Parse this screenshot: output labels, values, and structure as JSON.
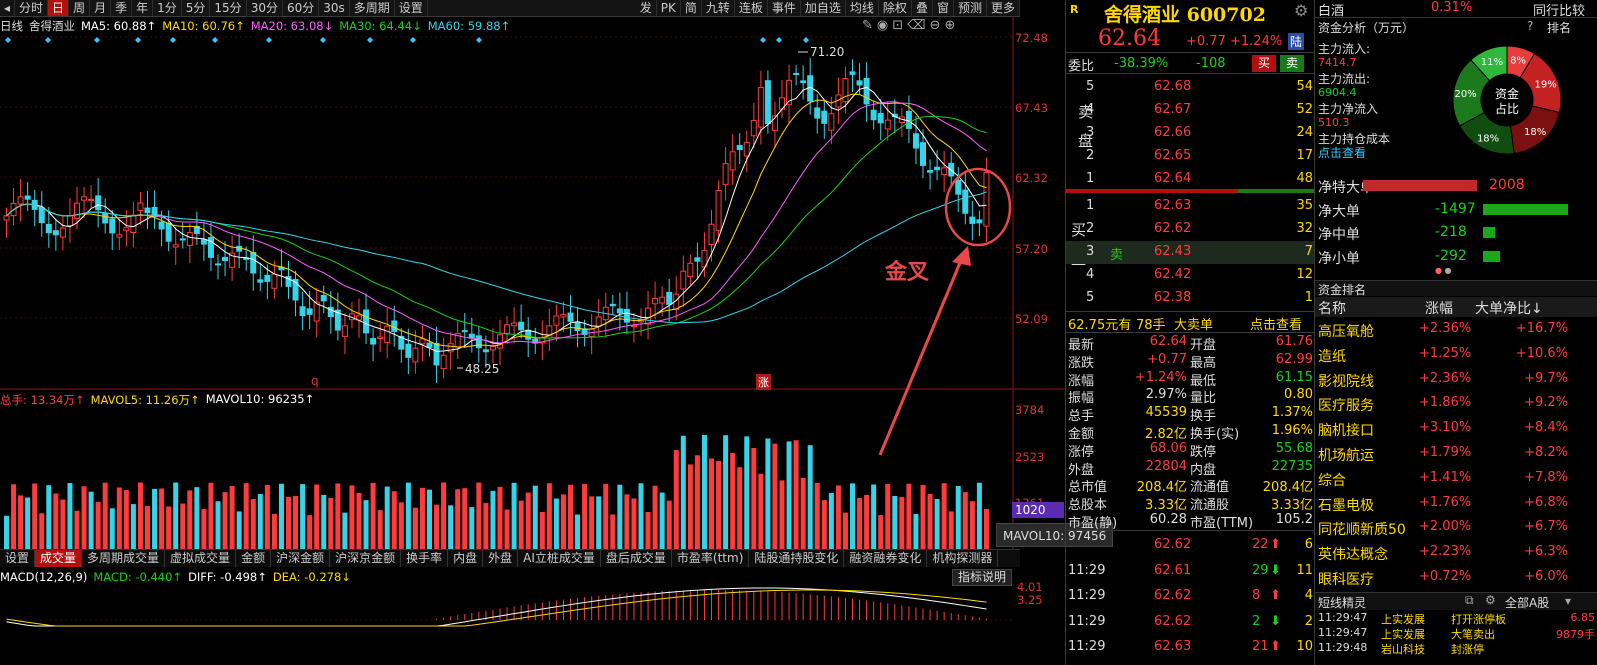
{
  "toolbar": {
    "items": [
      "分时",
      "日",
      "周",
      "月",
      "季",
      "年",
      "1分",
      "5分",
      "15分",
      "30分",
      "60分",
      "30s",
      "多周期",
      "设置"
    ],
    "active_index": 1,
    "right_items": [
      "发",
      "PK",
      "简",
      "九转",
      "连板",
      "事件",
      "加自选",
      "均线",
      "除权",
      "叠",
      "窗",
      "预测",
      "更多"
    ]
  },
  "info_line": {
    "period": "日线",
    "stock_name": "舍得酒业",
    "ma5": "MA5: 60.88↑",
    "ma10": "MA10: 60.76↑",
    "ma20": "MA20: 63.08↓",
    "ma30": "MA30: 64.44↓",
    "ma60": "MA60: 59.88↑"
  },
  "price_axis": [
    "72.48",
    "67.43",
    "62.32",
    "57.20",
    "52.09"
  ],
  "price_labels": {
    "high": "71.20",
    "low": "48.25",
    "q_marker": "q",
    "zhang_marker": "涨"
  },
  "annotation": {
    "text": "金叉",
    "color": "#e84848"
  },
  "volume_info": {
    "total": "总手: 13.34万↑",
    "mavol5": "MAVOL5: 11.26万↑",
    "mavol10": "MAVOL10: 96235↑"
  },
  "volume_axis": [
    "3784",
    "2523",
    "1261"
  ],
  "volume_current": "1020",
  "tooltip": "MAVOL10: 97456",
  "bottom_tabs": [
    "设置",
    "成交量",
    "多周期成交量",
    "虚拟成交量",
    "金额",
    "沪深金额",
    "沪深京金额",
    "换手率",
    "内盘",
    "外盘",
    "AI立桩成交量",
    "盘后成交量",
    "市盈率(ttm)",
    "陆股通持股变化",
    "融资融券变化",
    "机构探测器"
  ],
  "bottom_tab_active": 1,
  "macd_info": {
    "label": "MACD(12,26,9)",
    "macd": "MACD: -0.440↑",
    "diff": "DIFF: -0.498↑",
    "dea": "DEA: -0.278↓"
  },
  "macd_axis": [
    "4.01",
    "3.25"
  ],
  "indicator_button": "指标说明",
  "quote": {
    "badge": "R",
    "title": "舍得酒业 600702",
    "price": "62.64",
    "change": "+0.77",
    "pct": "+1.24%",
    "exchange_tag": "陆",
    "weibi_label": "委比",
    "weibi": "-38.39%",
    "weicha": "-108",
    "buy_btn": "买",
    "sell_btn": "卖"
  },
  "sell_orders": [
    {
      "level": "5",
      "price": "62.68",
      "vol": "54"
    },
    {
      "level": "4",
      "price": "62.67",
      "vol": "52"
    },
    {
      "level": "3",
      "price": "62.66",
      "vol": "24"
    },
    {
      "level": "2",
      "price": "62.65",
      "vol": "17"
    },
    {
      "level": "1",
      "price": "62.64",
      "vol": "48"
    }
  ],
  "sell_side_label": "卖盘",
  "buy_orders": [
    {
      "level": "1",
      "price": "62.63",
      "vol": "35"
    },
    {
      "level": "2",
      "price": "62.62",
      "vol": "32"
    },
    {
      "level": "3",
      "price": "62.43",
      "vol": "7",
      "tag": "卖"
    },
    {
      "level": "4",
      "price": "62.42",
      "vol": "12"
    },
    {
      "level": "5",
      "price": "62.38",
      "vol": "1"
    }
  ],
  "buy_side_label": "买盘",
  "big_order_line": {
    "amount": "62.75元有",
    "hands": "78手",
    "label": "大卖单",
    "link": "点击查看"
  },
  "stats": [
    {
      "k1": "最新",
      "v1": "62.64",
      "k2": "开盘",
      "v2": "61.76"
    },
    {
      "k1": "涨跌",
      "v1": "+0.77",
      "k2": "最高",
      "v2": "62.99"
    },
    {
      "k1": "涨幅",
      "v1": "+1.24%",
      "k2": "最低",
      "v2": "61.15"
    },
    {
      "k1": "振幅",
      "v1": "2.97%",
      "k2": "量比",
      "v2": "0.80"
    },
    {
      "k1": "总手",
      "v1": "45539",
      "k2": "换手",
      "v2": "1.37%"
    },
    {
      "k1": "金额",
      "v1": "2.82亿",
      "k2": "换手(实)",
      "v2": "1.96%"
    },
    {
      "k1": "涨停",
      "v1": "68.06",
      "k2": "跌停",
      "v2": "55.68"
    },
    {
      "k1": "外盘",
      "v1": "22804",
      "k2": "内盘",
      "v2": "22735"
    },
    {
      "k1": "总市值",
      "v1": "208.4亿",
      "k2": "流通值",
      "v2": "208.4亿"
    },
    {
      "k1": "总股本",
      "v1": "3.33亿",
      "k2": "流通股",
      "v2": "3.33亿"
    },
    {
      "k1": "市盈(静)",
      "v1": "60.28",
      "k2": "市盈(TTM)",
      "v2": "105.2"
    }
  ],
  "ticks": [
    {
      "time": "",
      "price": "62.62",
      "vol": "22",
      "dir": "up",
      "n": "6"
    },
    {
      "time": "11:29",
      "price": "62.61",
      "vol": "29",
      "dir": "down",
      "n": "11"
    },
    {
      "time": "11:29",
      "price": "62.62",
      "vol": "8",
      "dir": "up",
      "n": "4"
    },
    {
      "time": "11:29",
      "price": "62.62",
      "vol": "2",
      "dir": "down",
      "n": "2"
    },
    {
      "time": "11:29",
      "price": "62.63",
      "vol": "21",
      "dir": "up",
      "n": "10"
    }
  ],
  "far_right": {
    "title": "白酒",
    "title_pct": "0.31%",
    "compare_label": "同行比较",
    "fund_label": "资金分析（万元）",
    "main_in_label": "主力流入:",
    "main_in": "7414.7",
    "main_out_label": "主力流出:",
    "main_out": "6904.4",
    "main_net_label": "主力净流入",
    "main_net": "510.3",
    "main_cost_label": "主力持仓成本",
    "click_view": "点击查看",
    "donut_center": [
      "资金",
      "占比"
    ],
    "donut_segments": [
      {
        "label": "11%",
        "value": 11,
        "color": "#2fb83a"
      },
      {
        "label": "8%",
        "value": 8,
        "color": "#e63c3c"
      },
      {
        "label": "19%",
        "value": 19,
        "color": "#c22222"
      },
      {
        "label": "18%",
        "value": 18,
        "color": "#7a1010"
      },
      {
        "label": "18%",
        "value": 18,
        "color": "#114d11"
      },
      {
        "label": "20%",
        "value": 20,
        "color": "#1c7a1c"
      }
    ],
    "net_rows": [
      {
        "label": "净特大单",
        "value": "2008",
        "bar_ratio": 0.95,
        "color": "#c42828",
        "vcolor": "#ff3b3b"
      },
      {
        "label": "净大单",
        "value": "-1497",
        "bar_ratio": 0.71,
        "color": "#1aa81a",
        "vcolor": "#17d117"
      },
      {
        "label": "净中单",
        "value": "-218",
        "bar_ratio": 0.1,
        "color": "#1aa81a",
        "vcolor": "#17d117"
      },
      {
        "label": "净小单",
        "value": "-292",
        "bar_ratio": 0.14,
        "color": "#1aa81a",
        "vcolor": "#17d117"
      }
    ],
    "rank_header": "资金排名",
    "rank_cols": [
      "名称",
      "涨幅",
      "大单净比↓"
    ],
    "rank_rows": [
      {
        "name": "高压氧舱",
        "pct": "+2.36%",
        "net": "+16.7%"
      },
      {
        "name": "造纸",
        "pct": "+1.25%",
        "net": "+10.6%"
      },
      {
        "name": "影视院线",
        "pct": "+2.36%",
        "net": "+9.7%"
      },
      {
        "name": "医疗服务",
        "pct": "+1.86%",
        "net": "+9.2%"
      },
      {
        "name": "脑机接口",
        "pct": "+3.10%",
        "net": "+8.4%"
      },
      {
        "name": "机场航运",
        "pct": "+1.79%",
        "net": "+8.2%"
      },
      {
        "name": "综合",
        "pct": "+1.41%",
        "net": "+7.8%"
      },
      {
        "name": "石墨电极",
        "pct": "+1.76%",
        "net": "+6.8%"
      },
      {
        "name": "同花顺新质50",
        "pct": "+2.00%",
        "net": "+6.7%"
      },
      {
        "name": "英伟达概念",
        "pct": "+2.23%",
        "net": "+6.3%"
      },
      {
        "name": "眼科医疗",
        "pct": "+0.72%",
        "net": "+6.0%"
      }
    ],
    "sprite_header": "短线精灵",
    "sprite_filter": "全部A股",
    "sprite_rows": [
      {
        "time": "11:29:47",
        "name": "上实发展",
        "event": "打开涨停板",
        "val": "6.85"
      },
      {
        "time": "11:29:47",
        "name": "上实发展",
        "event": "大笔卖出",
        "val": "9879手"
      },
      {
        "time": "11:29:48",
        "name": "岩山科技",
        "event": "封涨停",
        "val": ""
      }
    ]
  },
  "colors": {
    "up": "#ff3b3b",
    "down": "#17d117",
    "ma5": "#ffffff",
    "ma10": "#ffd800",
    "ma20": "#ff5cff",
    "ma30": "#17d117",
    "ma60": "#35d4e8",
    "candle_down": "#35d4e8"
  }
}
